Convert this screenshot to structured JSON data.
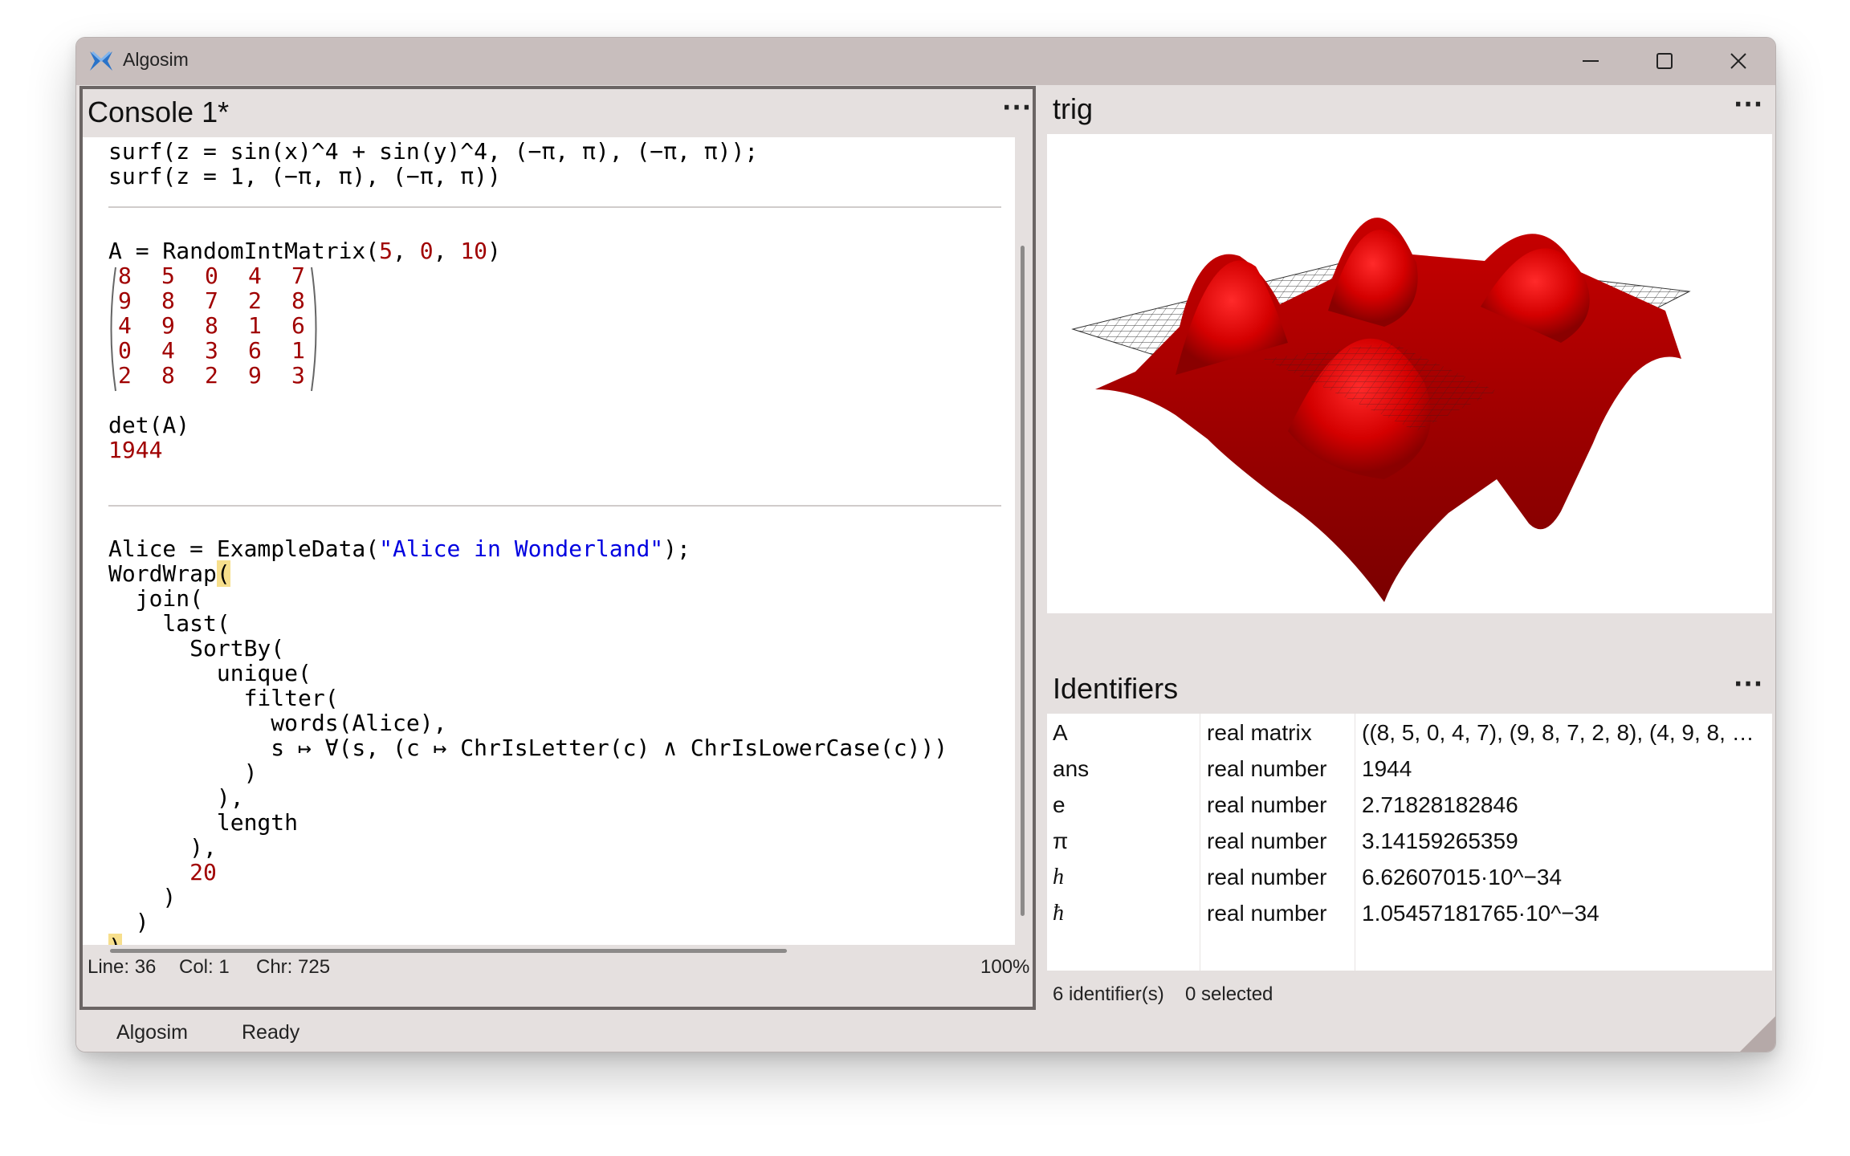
{
  "app": {
    "title": "Algosim"
  },
  "window_controls": {
    "minimize": "minimize-icon",
    "maximize": "maximize-icon",
    "close": "close-icon"
  },
  "console": {
    "title": "Console 1*",
    "menu": "···",
    "lines": {
      "l1": "surf(z = sin(x)^4 + sin(y)^4, (−π, π), (−π, π));",
      "l2": "surf(z = 1, (−π, π), (−π, π))",
      "l3a": "A = RandomIntMatrix(",
      "l3b": "5",
      "l3c": ", ",
      "l3d": "0",
      "l3e": ", ",
      "l3f": "10",
      "l3g": ")",
      "l4": "det(A)",
      "l5": "1944",
      "l6a": "Alice = ExampleData(",
      "l6b": "\"Alice in Wonderland\"",
      "l6c": ");",
      "l7a": "WordWrap",
      "l7b": "(",
      "l8": "  join(",
      "l9": "    last(",
      "l10": "      SortBy(",
      "l11": "        unique(",
      "l12": "          filter(",
      "l13": "            words(Alice),",
      "l14": "            s ↦ ∀(s, (c ↦ ChrIsLetter(c) ∧ ChrIsLowerCase(c)))",
      "l15": "          )",
      "l16": "        ),",
      "l17": "        length",
      "l18": "      ),",
      "l19": "20",
      "l20": "    )",
      "l21": "  )",
      "l22": ")"
    },
    "matrix": [
      [
        "8",
        "5",
        "0",
        "4",
        "7"
      ],
      [
        "9",
        "8",
        "7",
        "2",
        "8"
      ],
      [
        "4",
        "9",
        "8",
        "1",
        "6"
      ],
      [
        "0",
        "4",
        "3",
        "6",
        "1"
      ],
      [
        "2",
        "8",
        "2",
        "9",
        "3"
      ]
    ],
    "status": {
      "line": "Line: 36",
      "col": "Col: 1",
      "chr": "Chr: 725",
      "zoom": "100%"
    }
  },
  "plot": {
    "title": "trig",
    "menu": "···",
    "surface_color": "#dd0000",
    "mesh_color": "#222222"
  },
  "identifiers": {
    "title": "Identifiers",
    "menu": "···",
    "rows": [
      {
        "name": "A",
        "type": "real matrix",
        "value": "((8, 5, 0, 4, 7), (9, 8, 7, 2, 8), (4, 9, 8, …"
      },
      {
        "name": "ans",
        "type": "real number",
        "value": "1944"
      },
      {
        "name": "e",
        "type": "real number",
        "value": "2.71828182846"
      },
      {
        "name": "π",
        "type": "real number",
        "value": "3.14159265359"
      },
      {
        "name": "h",
        "type": "real number",
        "value": "6.62607015·10^−34"
      },
      {
        "name": "ħ",
        "type": "real number",
        "value": "1.05457181765·10^−34"
      }
    ],
    "status": {
      "count": "6 identifier(s)",
      "selected": "0 selected"
    }
  },
  "footer": {
    "app": "Algosim",
    "state": "Ready"
  }
}
